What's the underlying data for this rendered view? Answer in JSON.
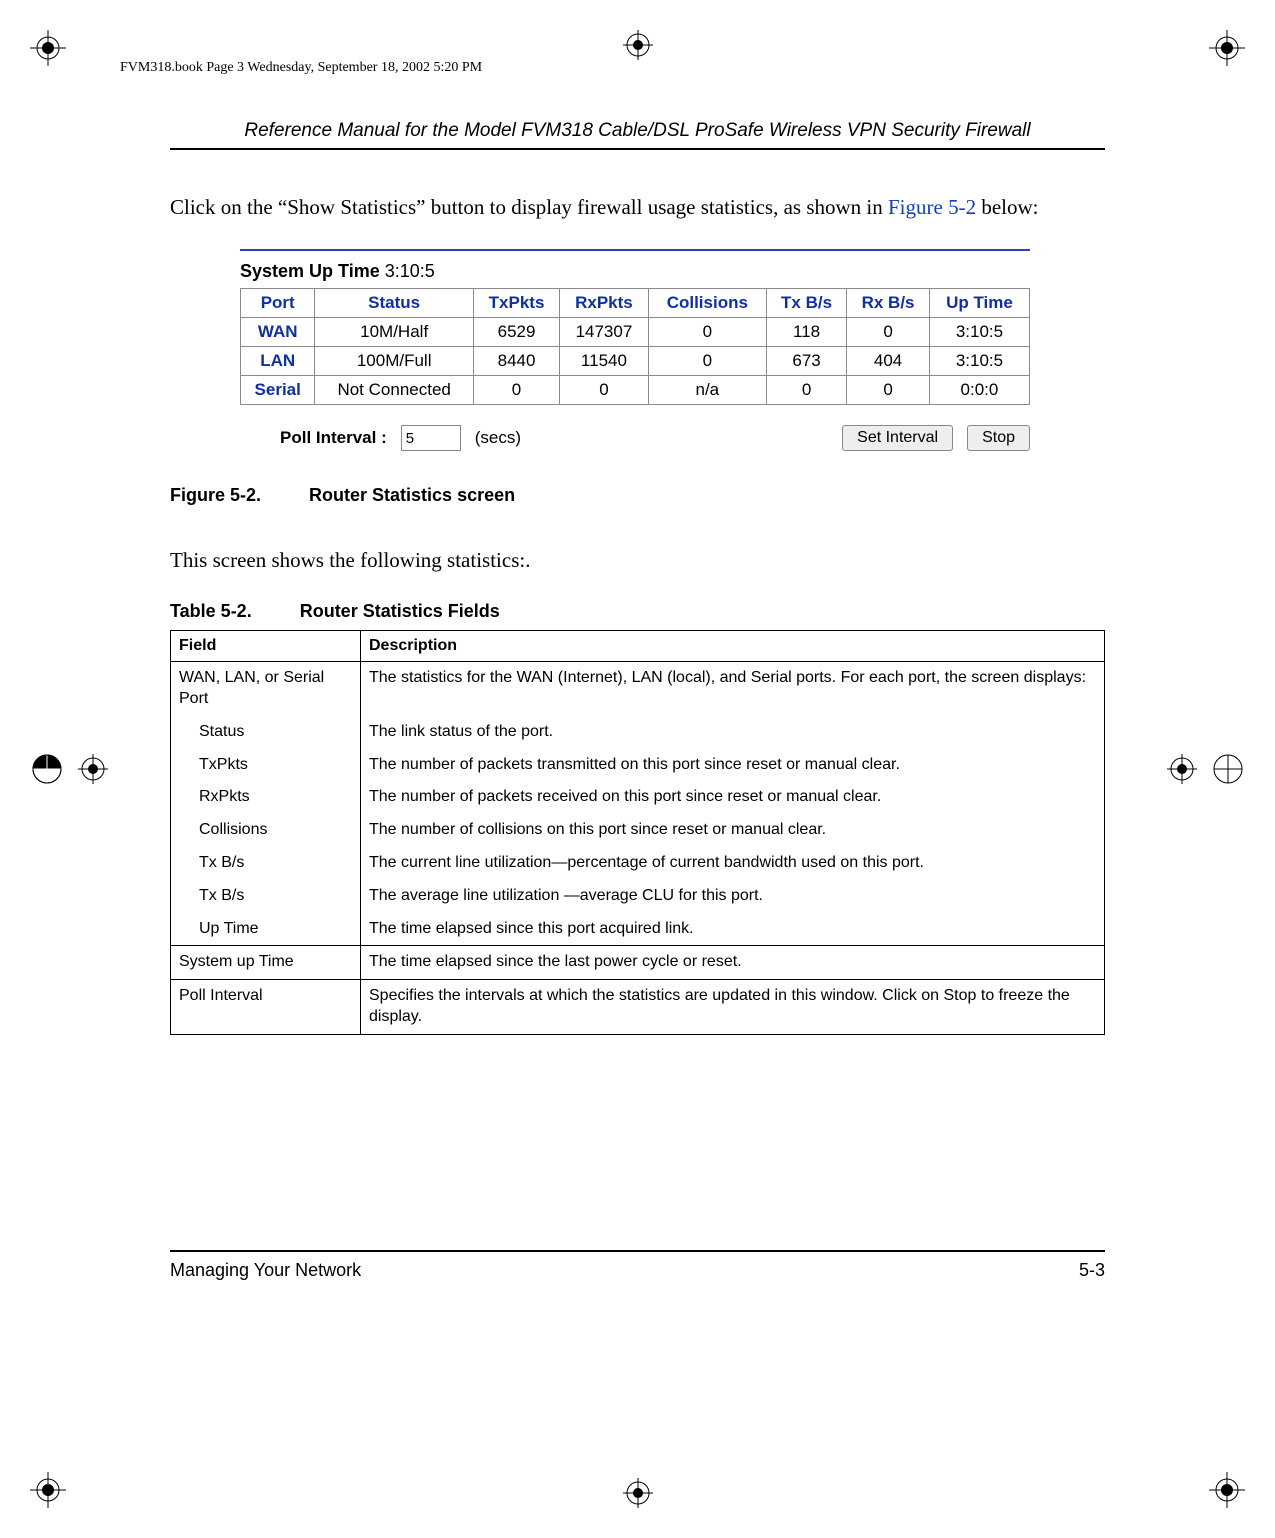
{
  "meta_line": "FVM318.book  Page 3  Wednesday, September 18, 2002  5:20 PM",
  "header_title": "Reference Manual for the Model FVM318 Cable/DSL ProSafe Wireless VPN Security Firewall",
  "intro_text_pre": "Click on the “Show Statistics” button to display firewall usage statistics, as shown in ",
  "intro_xref": "Figure 5-2",
  "intro_text_post": " below:",
  "uptime_label": "System Up Time",
  "uptime_value": "3:10:5",
  "stats_headers": [
    "Port",
    "Status",
    "TxPkts",
    "RxPkts",
    "Collisions",
    "Tx B/s",
    "Rx B/s",
    "Up Time"
  ],
  "stats_rows": [
    {
      "port": "WAN",
      "status": "10M/Half",
      "tx": "6529",
      "rx": "147307",
      "col": "0",
      "txbs": "118",
      "rxbs": "0",
      "up": "3:10:5"
    },
    {
      "port": "LAN",
      "status": "100M/Full",
      "tx": "8440",
      "rx": "11540",
      "col": "0",
      "txbs": "673",
      "rxbs": "404",
      "up": "3:10:5"
    },
    {
      "port": "Serial",
      "status": "Not Connected",
      "tx": "0",
      "rx": "0",
      "col": "n/a",
      "txbs": "0",
      "rxbs": "0",
      "up": "0:0:0"
    }
  ],
  "poll_label": "Poll Interval :",
  "poll_value": "5",
  "poll_secs": "(secs)",
  "btn_setinterval": "Set Interval",
  "btn_stop": "Stop",
  "figure_caption_num": "Figure 5-2.",
  "figure_caption_text": "Router Statistics screen",
  "para2": "This screen shows the following statistics:.",
  "table_caption_num": "Table 5-2.",
  "table_caption_text": "Router Statistics Fields",
  "fields_headers": [
    "Field",
    "Description"
  ],
  "fields_rows": [
    {
      "field": "WAN, LAN, or Serial Port",
      "desc": "The statistics for the WAN (Internet), LAN (local), and Serial ports. For each port, the screen displays:",
      "indent": false,
      "group": "start"
    },
    {
      "field": "Status",
      "desc": "The link status of the port.",
      "indent": true,
      "group": "mid"
    },
    {
      "field": "TxPkts",
      "desc": "The number of packets transmitted on this port since reset or manual clear.",
      "indent": true,
      "group": "mid"
    },
    {
      "field": "RxPkts",
      "desc": "The number of packets received on this port since reset or manual clear.",
      "indent": true,
      "group": "mid"
    },
    {
      "field": "Collisions",
      "desc": "The number of collisions on this port since reset or manual clear.",
      "indent": true,
      "group": "mid"
    },
    {
      "field": "Tx B/s",
      "desc": "The current line utilization—percentage of current bandwidth used on this port.",
      "indent": true,
      "group": "mid"
    },
    {
      "field": "Tx B/s",
      "desc": "The average line utilization —average CLU for this port.",
      "indent": true,
      "group": "mid"
    },
    {
      "field": "Up Time",
      "desc": "The time elapsed since this port acquired link.",
      "indent": true,
      "group": "end"
    },
    {
      "field": "System up Time",
      "desc": "The time elapsed since the last power cycle or reset.",
      "indent": false,
      "group": "single"
    },
    {
      "field": "Poll Interval",
      "desc": "Specifies the intervals at which the statistics are updated in this window. Click on Stop to freeze the display.",
      "indent": false,
      "group": "single"
    }
  ],
  "footer_left": "Managing Your Network",
  "footer_right": "5-3"
}
